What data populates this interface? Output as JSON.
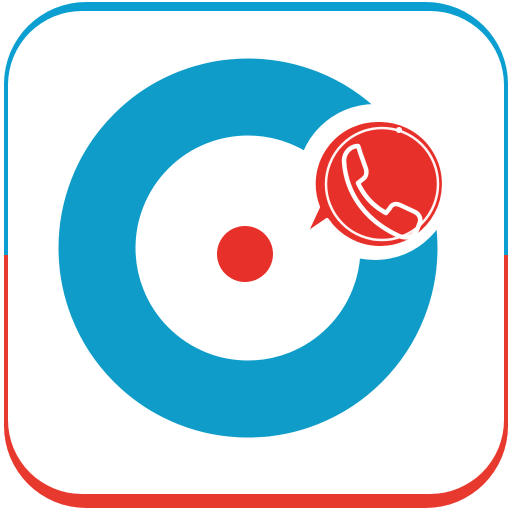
{
  "app_icon": {
    "name": "call-app-icon",
    "colors": {
      "frame_top": "#0a9fd0",
      "frame_bottom": "#e8392f",
      "tile_background": "#ffffff",
      "ring": "#0f9cc9",
      "dot": "#e8302a",
      "bubble": "#e8302a",
      "bubble_border": "#ffffff",
      "glyph": "#ffffff"
    },
    "icons": [
      "ring-icon",
      "center-dot-icon",
      "speech-bubble-icon",
      "phone-handset-icon"
    ]
  }
}
